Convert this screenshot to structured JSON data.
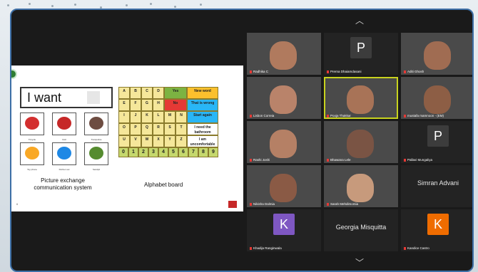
{
  "slide": {
    "i_want": "I want",
    "picture_caption_line1": "Picture exchange",
    "picture_caption_line2": "communication system",
    "board_caption": "Alphabet board",
    "page_number": "6",
    "picture_items": [
      {
        "label": "Tricycle",
        "color": "#d32f2f"
      },
      {
        "label": "Doll",
        "color": "#c62828"
      },
      {
        "label": "Trampoline",
        "color": "#6d4c41"
      },
      {
        "label": "Toy phone",
        "color": "#f9a825"
      },
      {
        "label": "Kitchen set",
        "color": "#1e88e5"
      },
      {
        "label": "Sandpit",
        "color": "#558b2f"
      }
    ],
    "alphabet_rows": [
      [
        "A",
        "B",
        "C",
        "D"
      ],
      [
        "E",
        "F",
        "G",
        "H"
      ],
      [
        "I",
        "J",
        "K",
        "L",
        "M",
        "N"
      ],
      [
        "O",
        "P",
        "Q",
        "R",
        "S",
        "T"
      ],
      [
        "U",
        "V",
        "W",
        "X",
        "Y",
        "Z"
      ]
    ],
    "word_cells": [
      {
        "text": "Yes",
        "color": "#7cb342"
      },
      {
        "text": "New word",
        "color": "#fbc02d"
      },
      {
        "text": "No",
        "color": "#e53935"
      },
      {
        "text": "That is wrong",
        "color": "#29b6f6"
      },
      {
        "text": "Start again",
        "color": "#29b6f6"
      },
      {
        "text": "I need the bathroom",
        "color": "#ffffff"
      },
      {
        "text": "I am uncomfortable",
        "color": "#ffffff"
      }
    ],
    "numbers": [
      "0",
      "1",
      "2",
      "3",
      "4",
      "5",
      "6",
      "7",
      "8",
      "9"
    ]
  },
  "participants": [
    {
      "name": "Radhika C",
      "type": "video",
      "skin": "#b07a5e"
    },
    {
      "name": "Prerna Dhaiamdasani",
      "type": "avatar",
      "initial": "P",
      "avatar_color": "#3c3c3c"
    },
    {
      "name": "Aditi Ghosh",
      "type": "video",
      "skin": "#a06c52"
    },
    {
      "name": "Lisbon Correia",
      "type": "video",
      "skin": "#b9836a"
    },
    {
      "name": "Pooja Thakkar",
      "type": "video",
      "skin": "#a87357",
      "active": true
    },
    {
      "name": "mustafa mamnoon - (EM)",
      "type": "video",
      "skin": "#8d5e45"
    },
    {
      "name": "Rashi Joshi",
      "type": "video",
      "skin": "#b58065"
    },
    {
      "name": "Bhawana Lele",
      "type": "video",
      "skin": "#7a5444"
    },
    {
      "name": "Pallavi Mungaliya",
      "type": "avatar",
      "initial": "P",
      "avatar_color": "#3c3c3c"
    },
    {
      "name": "Nikisha Dalmia",
      "type": "video",
      "skin": "#8a5a45"
    },
    {
      "name": "Sarah Mehdimomia",
      "type": "video",
      "skin": "#c79a7c"
    },
    {
      "name": "Simran Advani",
      "type": "name"
    },
    {
      "name": "Khadija Ranginwala",
      "type": "avatar",
      "initial": "K",
      "avatar_color": "#7e57c2"
    },
    {
      "name": "Georgia Misquitta",
      "type": "name"
    },
    {
      "name": "Kandice Castro",
      "type": "avatar",
      "initial": "K",
      "avatar_color": "#ef6c00"
    }
  ],
  "controls": {
    "up_icon": "chevron-up-icon",
    "down_icon": "chevron-down-icon"
  }
}
